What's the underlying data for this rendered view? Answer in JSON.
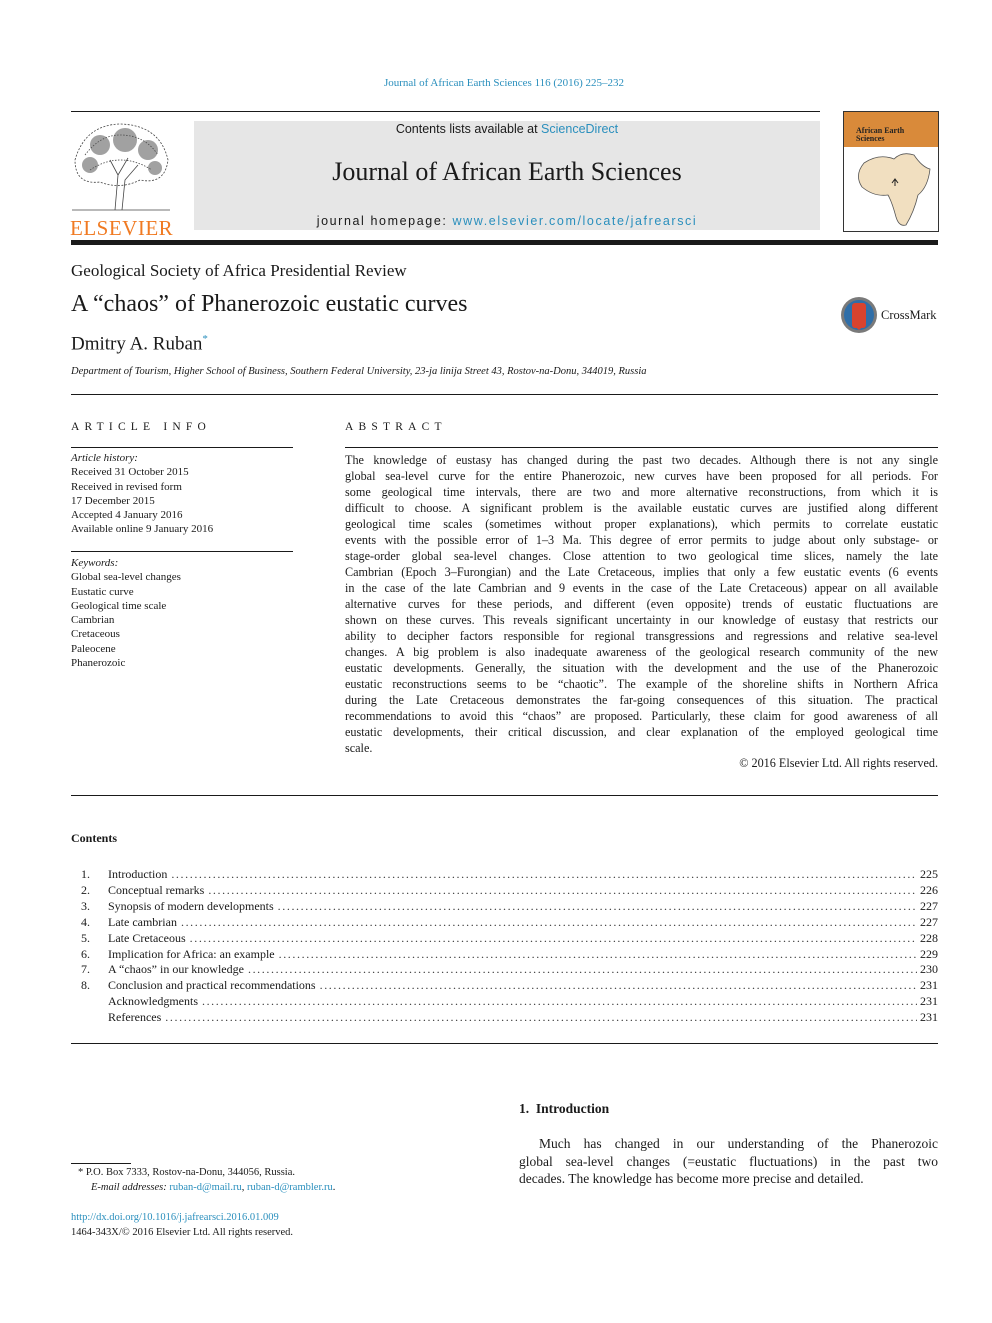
{
  "header": {
    "citation": "Journal of African Earth Sciences 116 (2016) 225–232",
    "contents_prefix": "Contents lists available at ",
    "contents_link": "ScienceDirect",
    "journal_title": "Journal of African Earth Sciences",
    "homepage_prefix": "journal homepage: ",
    "homepage_link": "www.elsevier.com/locate/jafrearsci",
    "publisher_logo_text": "ELSEVIER",
    "cover_title": "African Earth Sciences",
    "colors": {
      "link": "#2a8fbd",
      "elsevier_orange": "#f07a22",
      "cover_orange": "#d98a3a",
      "header_box": "#e6e6e6"
    }
  },
  "article": {
    "section_type": "Geological Society of Africa Presidential Review",
    "title": "A “chaos” of Phanerozoic eustatic curves",
    "author": "Dmitry A. Ruban",
    "author_mark": "*",
    "affiliation": "Department of Tourism, Higher School of Business, Southern Federal University, 23-ja linija Street 43, Rostov-na-Donu, 344019, Russia",
    "crossmark_label": "CrossMark"
  },
  "article_info": {
    "heading": "ARTICLE INFO",
    "history_label": "Article history:",
    "history": [
      "Received 31 October 2015",
      "Received in revised form",
      "17 December 2015",
      "Accepted 4 January 2016",
      "Available online 9 January 2016"
    ],
    "keywords_label": "Keywords:",
    "keywords": [
      "Global sea-level changes",
      "Eustatic curve",
      "Geological time scale",
      "Cambrian",
      "Cretaceous",
      "Paleocene",
      "Phanerozoic"
    ]
  },
  "abstract": {
    "heading": "ABSTRACT",
    "lines": [
      "The knowledge of eustasy has changed during the past two decades. Although there is not any single",
      "global sea-level curve for the entire Phanerozoic, new curves have been proposed for all periods. For",
      "some geological time intervals, there are two and more alternative reconstructions, from which it is",
      "difficult to choose. A significant problem is the available eustatic curves are justified along different",
      "geological time scales (sometimes without proper explanations), which permits to correlate eustatic",
      "events with the possible error of 1–3 Ma. This degree of error permits to judge about only substage- or",
      "stage-order global sea-level changes. Close attention to two geological time slices, namely the late",
      "Cambrian (Epoch 3–Furongian) and the Late Cretaceous, implies that only a few eustatic events (6 events",
      "in the case of the late Cambrian and 9 events in the case of the Late Cretaceous) appear on all available",
      "alternative curves for these periods, and different (even opposite) trends of eustatic fluctuations are",
      "shown on these curves. This reveals significant uncertainty in our knowledge of eustasy that restricts our",
      "ability to decipher factors responsible for regional transgressions and regressions and relative sea-level",
      "changes. A big problem is also inadequate awareness of the geological research community of the new",
      "eustatic developments. Generally, the situation with the development and the use of the Phanerozoic",
      "eustatic reconstructions seems to be “chaotic”. The example of the shoreline shifts in Northern Africa",
      "during the Late Cretaceous demonstrates the far-going consequences of this situation. The practical",
      "recommendations to avoid this “chaos” are proposed. Particularly, these claim for good awareness of all",
      "eustatic developments, their critical discussion, and clear explanation of the employed geological time",
      "scale."
    ],
    "copyright": "© 2016 Elsevier Ltd. All rights reserved."
  },
  "contents": {
    "heading": "Contents",
    "items": [
      {
        "num": "1.",
        "title": "Introduction",
        "page": "225"
      },
      {
        "num": "2.",
        "title": "Conceptual remarks",
        "page": "226"
      },
      {
        "num": "3.",
        "title": "Synopsis of modern developments",
        "page": "227"
      },
      {
        "num": "4.",
        "title": "Late cambrian",
        "page": "227"
      },
      {
        "num": "5.",
        "title": "Late Cretaceous",
        "page": "228"
      },
      {
        "num": "6.",
        "title": "Implication for Africa: an example",
        "page": "229"
      },
      {
        "num": "7.",
        "title": "A “chaos” in our knowledge",
        "page": "230"
      },
      {
        "num": "8.",
        "title": "Conclusion and practical recommendations",
        "page": "231"
      },
      {
        "num": "",
        "title": "Acknowledgments",
        "page": "231"
      },
      {
        "num": "",
        "title": "References",
        "page": "231"
      }
    ]
  },
  "introduction": {
    "heading": "1.  Introduction",
    "lines": [
      "Much has changed in our understanding of the Phanerozoic",
      "global sea-level changes (=eustatic fluctuations) in the past two",
      "decades. The knowledge has become more precise and detailed."
    ]
  },
  "footnote": {
    "mark": "*",
    "address": "P.O. Box 7333, Rostov-na-Donu, 344056, Russia.",
    "email_label": "E-mail addresses: ",
    "emails": [
      "ruban-d@mail.ru",
      "ruban-d@rambler.ru"
    ],
    "doi": "http://dx.doi.org/10.1016/j.jafrearsci.2016.01.009",
    "issn_copyright": "1464-343X/© 2016 Elsevier Ltd. All rights reserved."
  }
}
